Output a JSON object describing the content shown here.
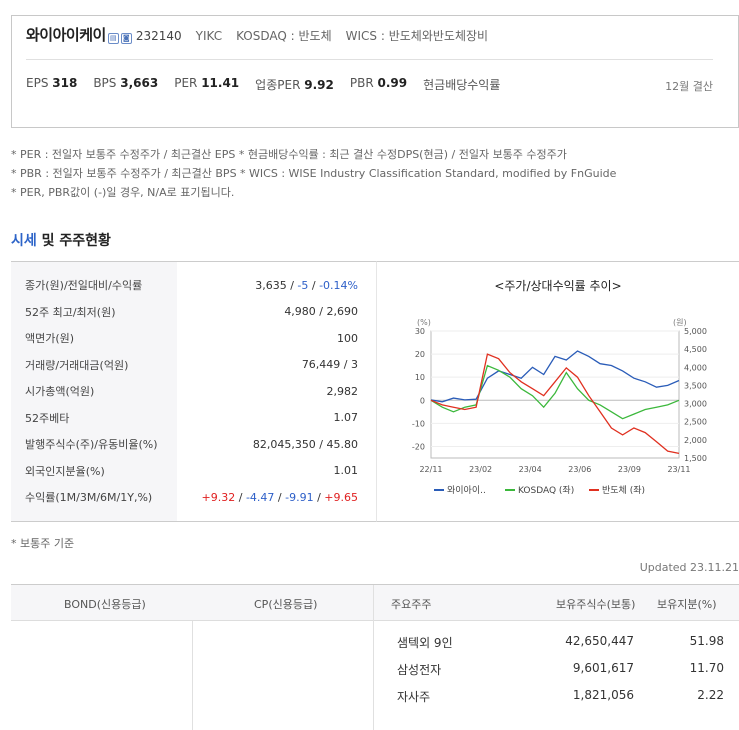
{
  "company": {
    "name": "와이아이케이",
    "icons": [
      "kospi-mini-icon",
      "info-mini-icon"
    ],
    "code": "232140",
    "ticker": "YIKC",
    "market": "KOSDAQ : 반도체",
    "wics": "WICS : 반도체와반도체장비"
  },
  "metrics": [
    {
      "label": "EPS",
      "value": "318"
    },
    {
      "label": "BPS",
      "value": "3,663"
    },
    {
      "label": "PER",
      "value": "11.41"
    },
    {
      "label": "업종PER",
      "value": "9.92"
    },
    {
      "label": "PBR",
      "value": "0.99"
    },
    {
      "label": "현금배당수익률",
      "value": ""
    }
  ],
  "settle": "12월 결산",
  "notes": [
    "* PER : 전일자 보통주 수정주가 / 최근결산 EPS * 현금배당수익률 : 최근 결산 수정DPS(현금) / 전일자 보통주 수정주가",
    "* PBR : 전일자 보통주 수정주가 / 최근결산 BPS * WICS : WISE Industry Classification Standard, modified by FnGuide",
    "* PER, PBR값이 (-)일 경우, N/A로 표기됩니다."
  ],
  "section": {
    "accent": "시세",
    "rest": " 및 주주현황"
  },
  "price_table": [
    {
      "label": "종가(원)/전일대비/수익률",
      "parts": [
        {
          "t": "3,635",
          "c": ""
        },
        {
          "t": " / ",
          "c": ""
        },
        {
          "t": "-5",
          "c": "blue"
        },
        {
          "t": " / ",
          "c": ""
        },
        {
          "t": "-0.14%",
          "c": "blue"
        }
      ]
    },
    {
      "label": "52주 최고/최저(원)",
      "parts": [
        {
          "t": "4,980 / 2,690",
          "c": ""
        }
      ]
    },
    {
      "label": "액면가(원)",
      "parts": [
        {
          "t": "100",
          "c": ""
        }
      ]
    },
    {
      "label": "거래량/거래대금(억원)",
      "parts": [
        {
          "t": "76,449 / 3",
          "c": ""
        }
      ]
    },
    {
      "label": "시가총액(억원)",
      "parts": [
        {
          "t": "2,982",
          "c": ""
        }
      ]
    },
    {
      "label": "52주베타",
      "parts": [
        {
          "t": "1.07",
          "c": ""
        }
      ]
    },
    {
      "label": "발행주식수(주)/유동비율(%)",
      "parts": [
        {
          "t": "82,045,350 / 45.80",
          "c": ""
        }
      ]
    },
    {
      "label": "외국인지분율(%)",
      "parts": [
        {
          "t": "1.01",
          "c": ""
        }
      ]
    },
    {
      "label": "수익률(1M/3M/6M/1Y,%)",
      "parts": [
        {
          "t": "+9.32",
          "c": "red"
        },
        {
          "t": " / ",
          "c": ""
        },
        {
          "t": "-4.47",
          "c": "blue"
        },
        {
          "t": " / ",
          "c": ""
        },
        {
          "t": "-9.91",
          "c": "blue"
        },
        {
          "t": " / ",
          "c": ""
        },
        {
          "t": "+9.65",
          "c": "red"
        }
      ]
    }
  ],
  "chart_data": {
    "type": "line",
    "title": "<주가/상대수익률 추이>",
    "left_unit": "(%)",
    "right_unit": "(원)",
    "left_ticks": [
      30,
      20,
      10,
      0,
      -10,
      -20
    ],
    "right_ticks": [
      "5,000",
      "4,500",
      "4,000",
      "3,500",
      "3,000",
      "2,500",
      "2,000",
      "1,500"
    ],
    "x_ticks": [
      "22/11",
      "23/02",
      "23/04",
      "23/06",
      "23/09",
      "23/11"
    ],
    "ylim_left": [
      -25,
      30
    ],
    "ylim_right": [
      1500,
      5000
    ],
    "grid": true,
    "legend_position": "bottom",
    "series": [
      {
        "name": "와이아이..",
        "axis": "right (주가, 원)",
        "color": "#2a5cb8",
        "values": [
          3100,
          3050,
          3150,
          3100,
          3120,
          3700,
          3900,
          3800,
          3700,
          4000,
          3800,
          4300,
          4200,
          4450,
          4300,
          4100,
          4050,
          3900,
          3700,
          3600,
          3450,
          3500,
          3635
        ]
      },
      {
        "name": "KOSDAQ (좌)",
        "axis": "left (%)",
        "color": "#3cb83c",
        "values": [
          0,
          -3,
          -5,
          -3,
          -2,
          15,
          13,
          10,
          5,
          2,
          -3,
          3,
          12,
          5,
          0,
          -2,
          -5,
          -8,
          -6,
          -4,
          -3,
          -2,
          0
        ]
      },
      {
        "name": "반도체 (좌)",
        "axis": "left (%)",
        "color": "#e03020",
        "values": [
          0,
          -2,
          -3,
          -4,
          -3,
          20,
          18,
          12,
          8,
          5,
          2,
          8,
          14,
          10,
          2,
          -5,
          -12,
          -15,
          -12,
          -14,
          -18,
          -22,
          -23
        ]
      }
    ]
  },
  "footnote": "* 보통주 기준",
  "updated": "Updated 23.11.21",
  "bottom_table": {
    "headers": {
      "bond": "BOND(신용등급)",
      "cp": "CP(신용등급)",
      "holder": "주요주주",
      "shares": "보유주식수(보통)",
      "pct": "보유지분(%)"
    },
    "holders": [
      {
        "name": "샘텍외 9인",
        "shares": "42,650,447",
        "pct": "51.98"
      },
      {
        "name": "삼성전자",
        "shares": "9,601,617",
        "pct": "11.70"
      },
      {
        "name": "자사주",
        "shares": "1,821,056",
        "pct": "2.22"
      }
    ]
  }
}
